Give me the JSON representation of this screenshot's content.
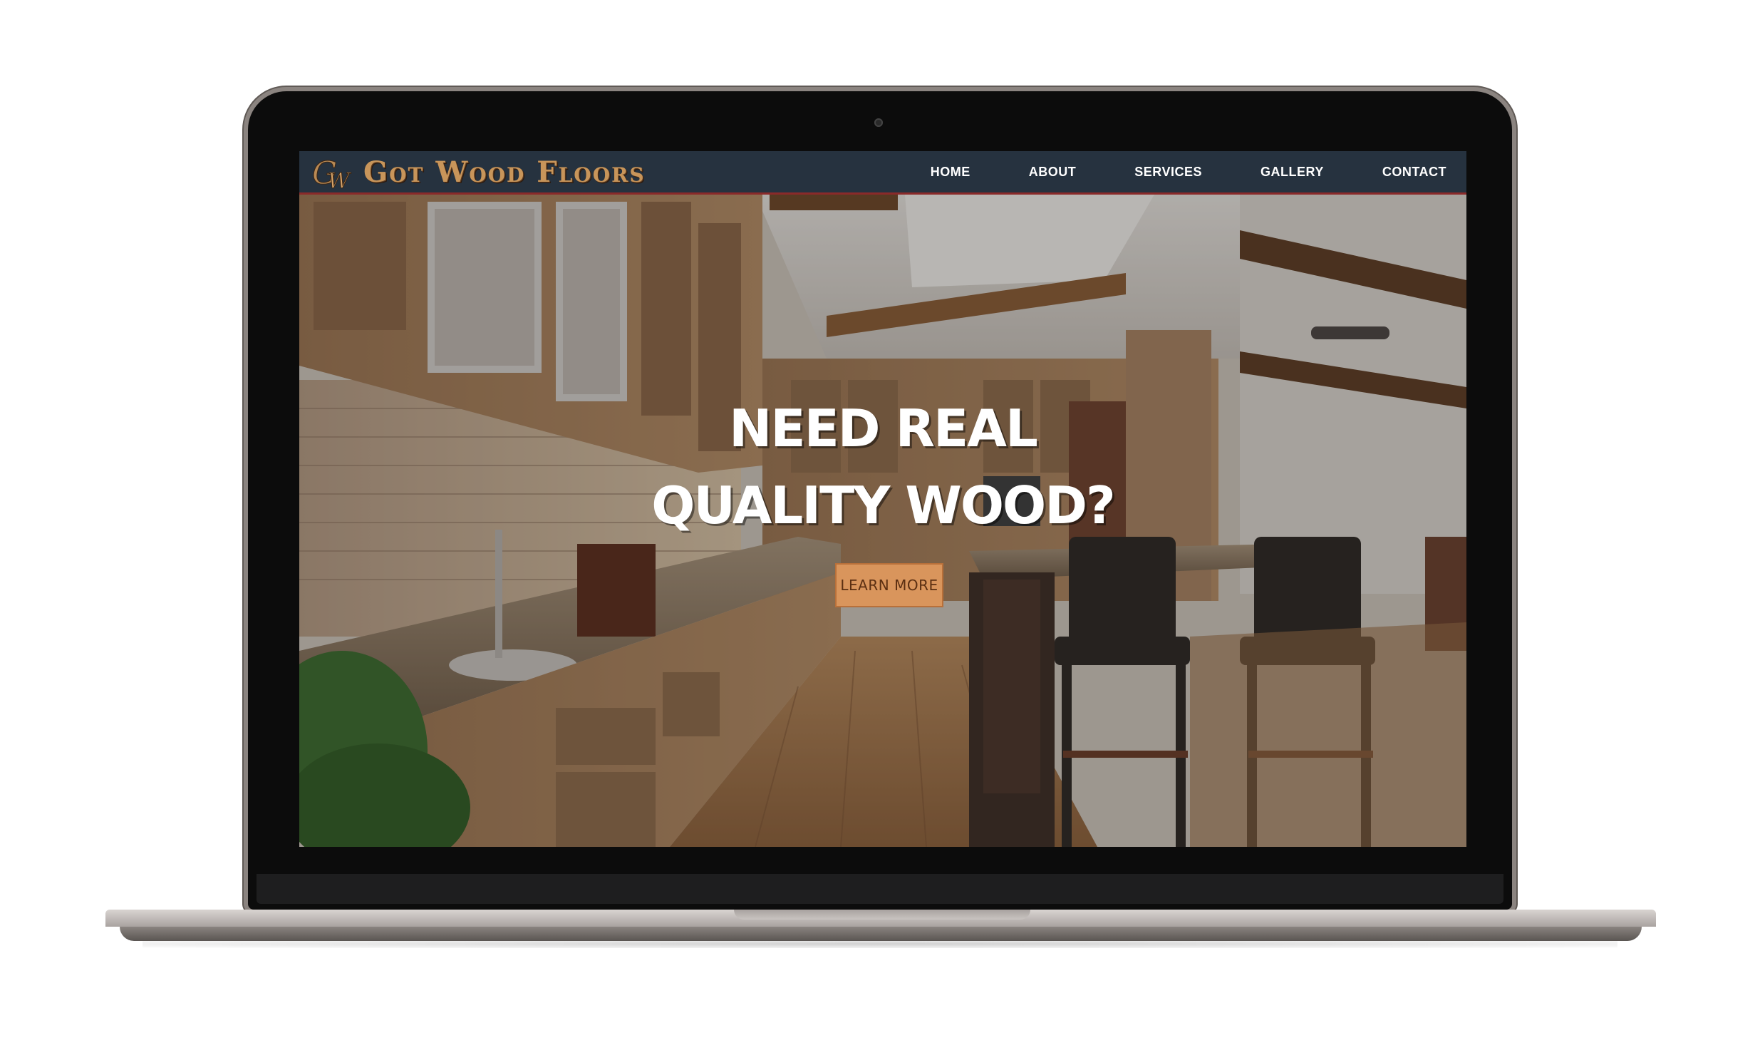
{
  "brand": {
    "logo_monogram": "GW",
    "name": "Got Wood Floors",
    "colors": {
      "nav_bg": "#26323f",
      "logo_gold": "#c8955a",
      "button": "#d9955c",
      "accent_line": "#8a2a2a"
    }
  },
  "nav": {
    "items": [
      {
        "label": "HOME"
      },
      {
        "label": "ABOUT"
      },
      {
        "label": "SERVICES"
      },
      {
        "label": "GALLERY"
      },
      {
        "label": "CONTACT"
      }
    ]
  },
  "hero": {
    "line1": "NEED REAL",
    "line2": "QUALITY WOOD?",
    "button_label": "LEARN MORE",
    "background": "kitchen-interior-photo"
  }
}
